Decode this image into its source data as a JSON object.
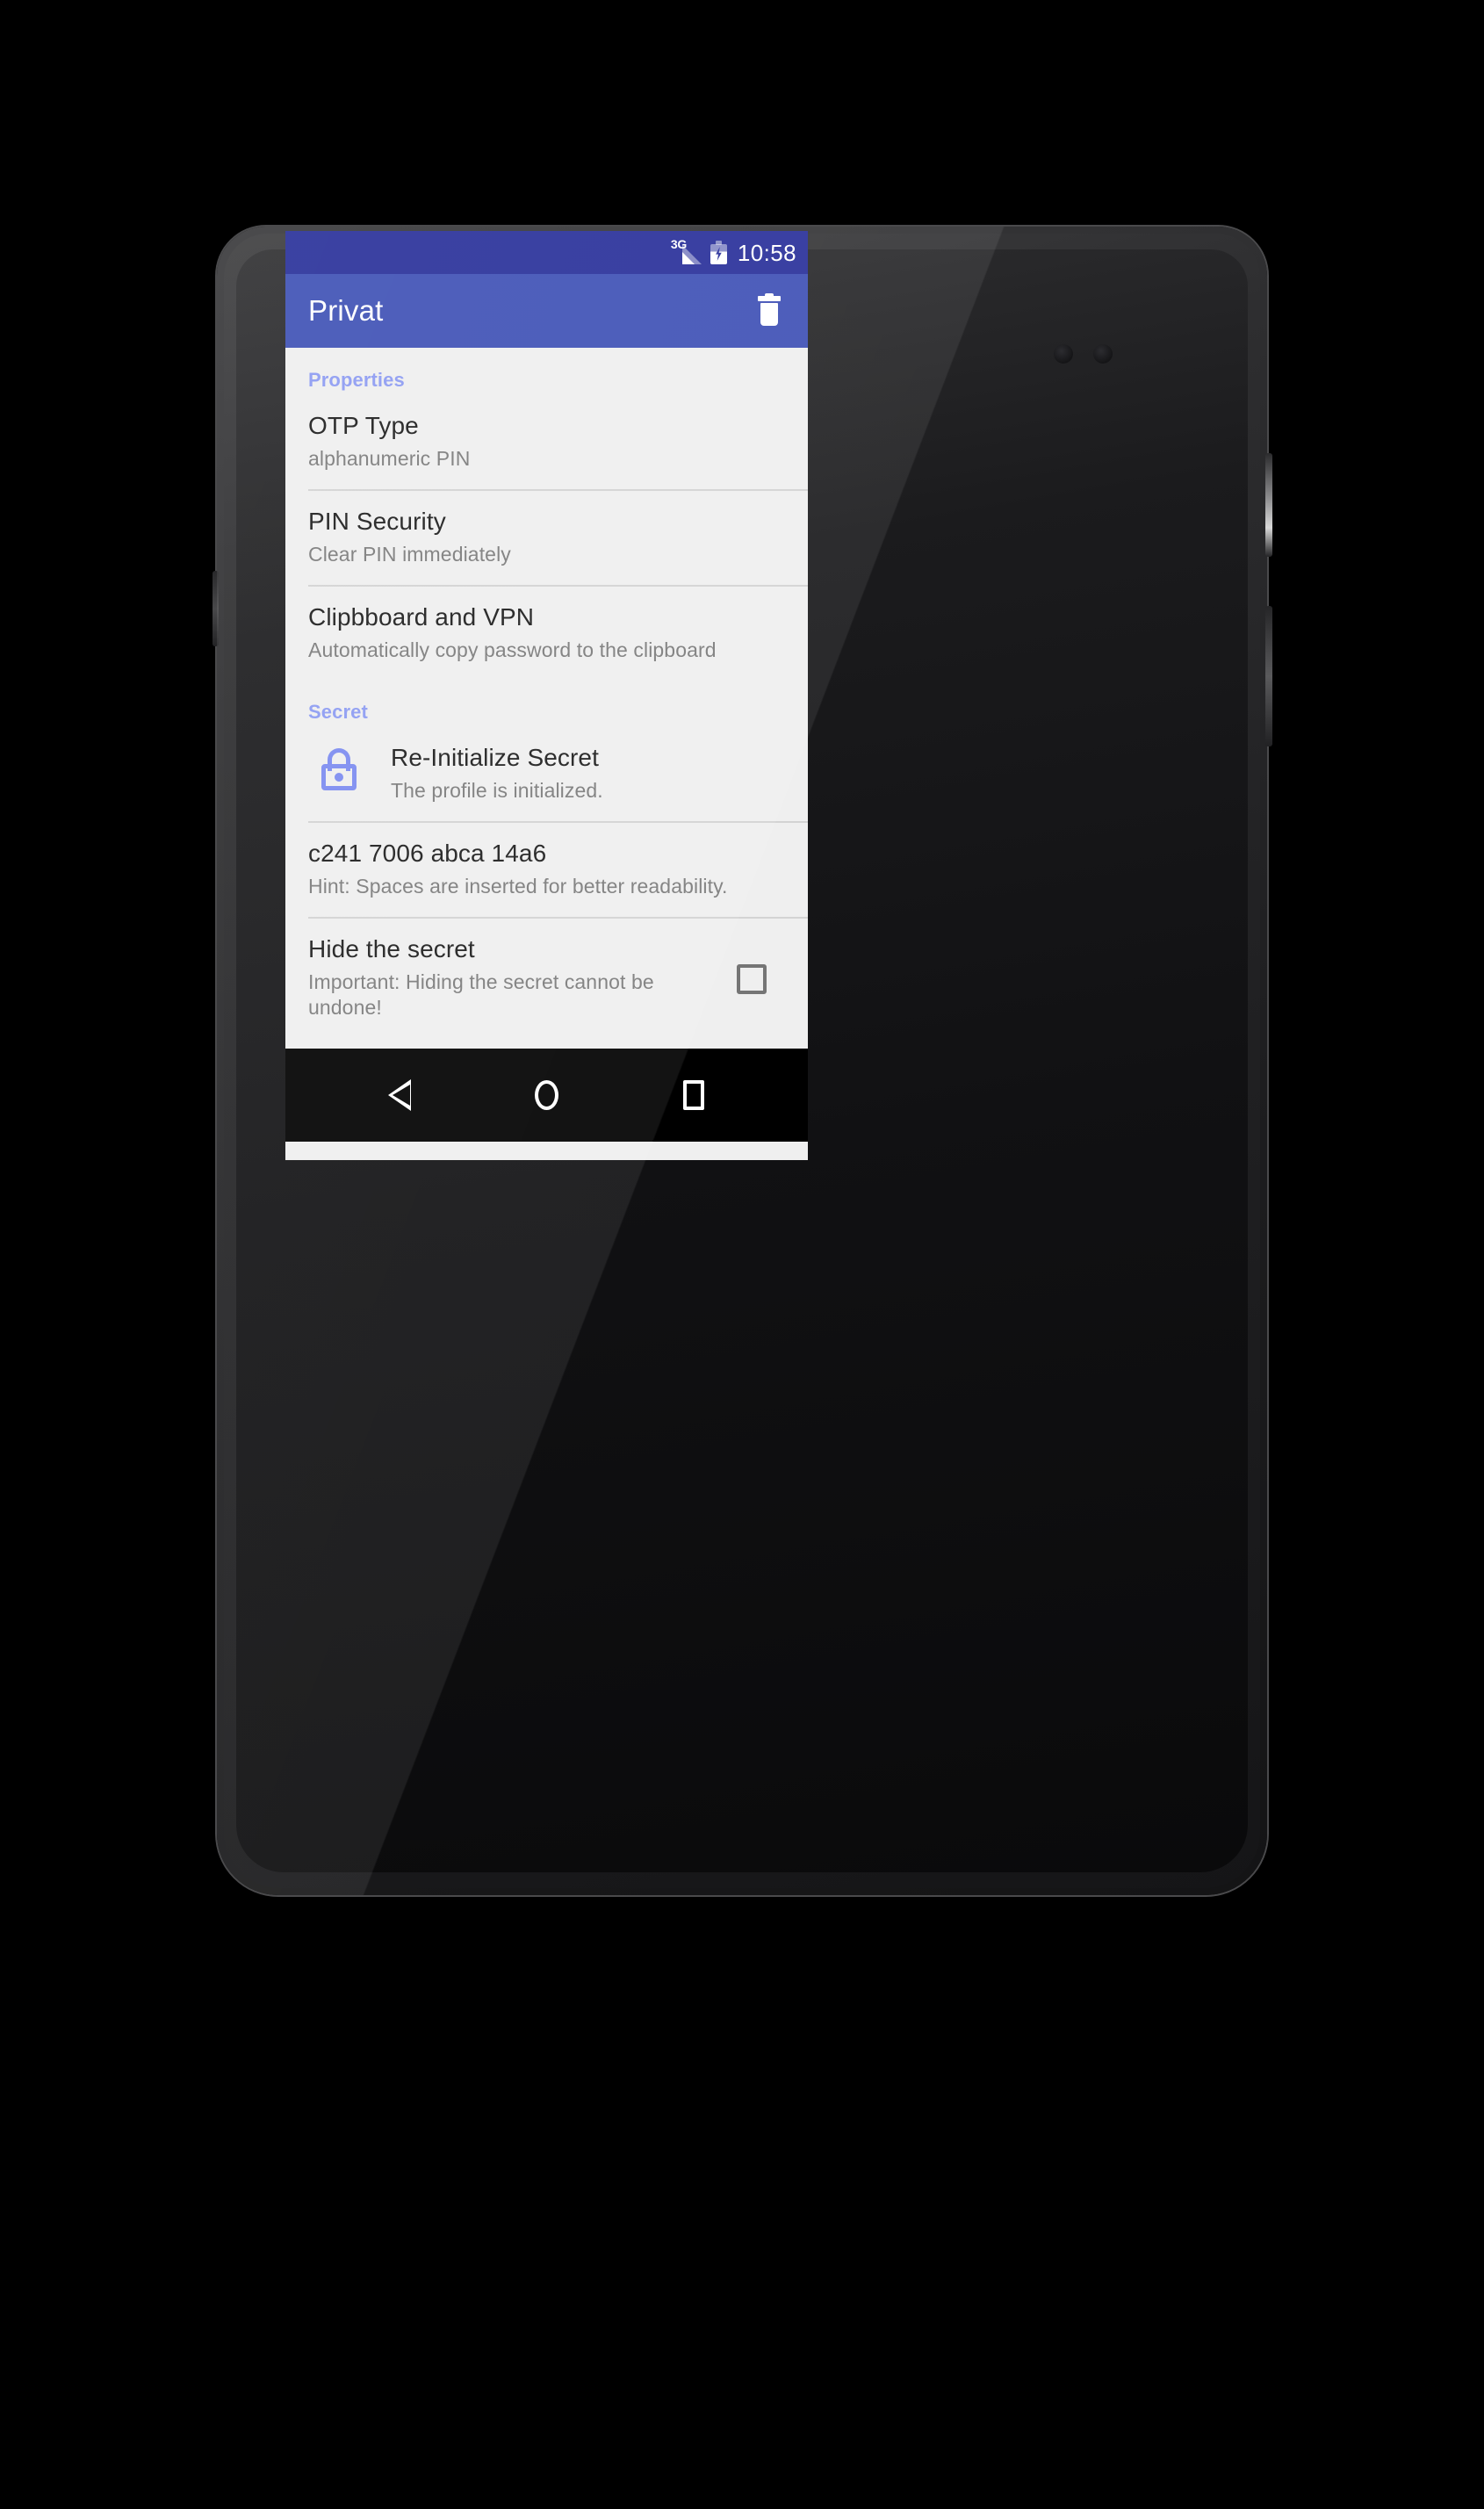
{
  "status_bar": {
    "network_label": "3G",
    "clock": "10:58",
    "signal_icon": "signal-bars-icon",
    "battery_icon": "battery-charging-icon",
    "background_color": "#29309A"
  },
  "app_bar": {
    "title": "Privat",
    "delete_icon": "trash-icon",
    "background_color": "#3F51B5",
    "title_color": "#FFFFFF"
  },
  "sections": [
    {
      "header": "Properties",
      "header_color": "#8C9BF2",
      "rows": [
        {
          "title": "OTP Type",
          "summary": "alphanumeric PIN"
        },
        {
          "title": "PIN Security",
          "summary": "Clear PIN immediately"
        },
        {
          "title": "Clipbboard and VPN",
          "summary": "Automatically copy password to the clipboard"
        }
      ]
    },
    {
      "header": "Secret",
      "header_color": "#8C9BF2",
      "rows": [
        {
          "title": "Re-Initialize Secret",
          "summary": "The profile is initialized.",
          "icon": "lock-icon",
          "icon_color": "#7B8BF0"
        },
        {
          "title": "c241 7006 abca 14a6",
          "summary": "Hint: Spaces are inserted for better readability."
        },
        {
          "title": "Hide the secret",
          "summary": "Important: Hiding the secret cannot be undone!",
          "checkbox_checked": false
        }
      ]
    }
  ],
  "nav_bar": {
    "back_icon": "back-triangle-icon",
    "home_icon": "home-circle-icon",
    "recents_icon": "recents-square-icon",
    "background_color": "#000000"
  },
  "device": {
    "front_camera_icon": "front-camera-icon",
    "earpiece_icon": "earpiece-speaker-icon",
    "proximity_sensor_icon": "proximity-sensor-icon",
    "power_button": "power-button",
    "volume_button": "volume-rocker-button",
    "sim_tray": "sim-tray"
  },
  "colors": {
    "screen_background": "#EFEFEF",
    "primary_text": "#1C1C1C",
    "secondary_text": "#7B7B7B",
    "divider": "#D3D3D3",
    "checkbox_border": "#757575"
  }
}
